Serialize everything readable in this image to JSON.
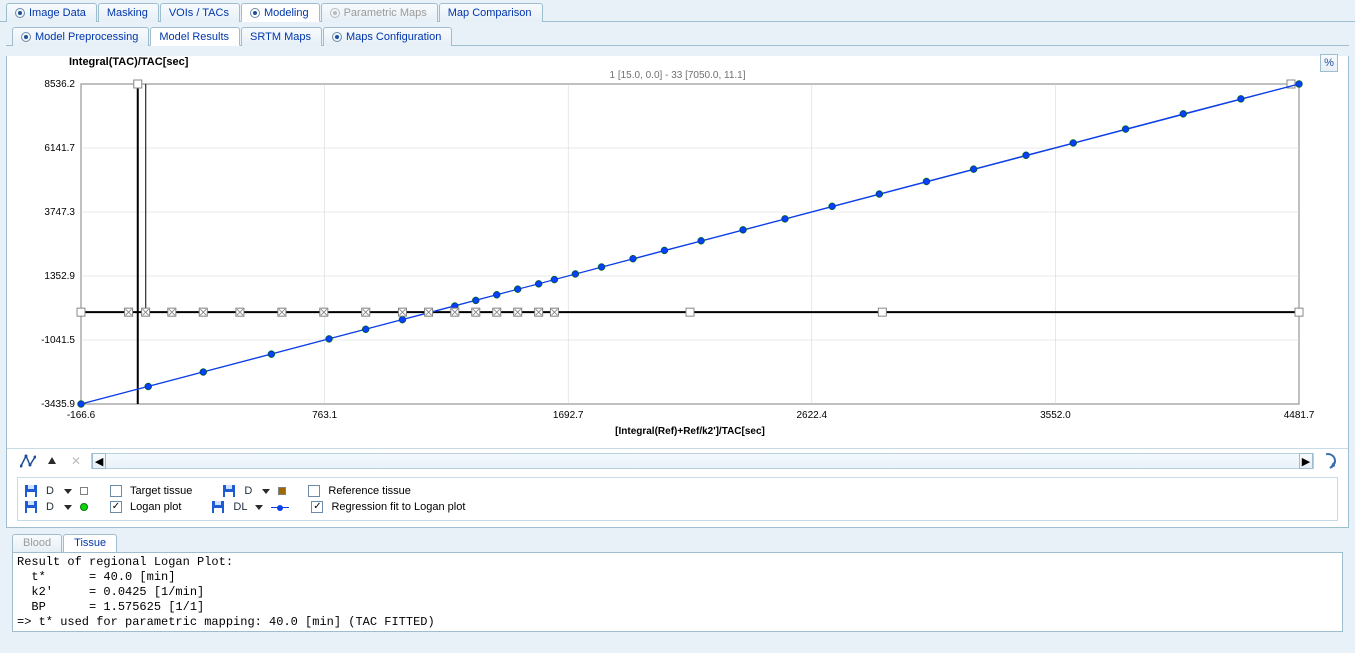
{
  "main_tabs": {
    "image_data": "Image Data",
    "masking": "Masking",
    "vois_tacs": "VOIs / TACs",
    "modeling": "Modeling",
    "parametric_maps": "Parametric Maps",
    "map_comparison": "Map Comparison"
  },
  "sub_tabs": {
    "model_preprocessing": "Model Preprocessing",
    "model_results": "Model Results",
    "srtm_maps": "SRTM Maps",
    "maps_configuration": "Maps Configuration"
  },
  "chart": {
    "title": "Integral(TAC)/TAC[sec]",
    "subtitle": "1 [15.0, 0.0] - 33 [7050.0, 11.1]",
    "xlabel": "[Integral(Ref)+Ref/k2']/TAC[sec]",
    "ylim": [
      -3435.9,
      8536.2
    ],
    "xlim": [
      -166.6,
      4481.7
    ],
    "yticks": [
      -3435.9,
      -1041.5,
      1352.9,
      3747.3,
      6141.7,
      8536.2
    ],
    "xticks": [
      -166.6,
      763.1,
      1692.7,
      2622.4,
      3552.0,
      4481.7
    ],
    "pct_label": "%"
  },
  "chart_data": {
    "type": "scatter+line",
    "title": "Integral(TAC)/TAC[sec]",
    "xlabel": "[Integral(Ref)+Ref/k2']/TAC[sec]",
    "ylabel": "Integral(TAC)/TAC[sec]",
    "xlim": [
      -166.6,
      4481.7
    ],
    "ylim": [
      -3435.9,
      8536.2
    ],
    "series": [
      {
        "name": "Target tissue",
        "marker": "square-open",
        "color": "#808080",
        "points": [
          [
            15,
            0
          ],
          [
            80,
            0
          ],
          [
            180,
            0
          ],
          [
            300,
            0
          ],
          [
            440,
            0
          ],
          [
            600,
            0
          ],
          [
            760,
            0
          ],
          [
            920,
            0
          ],
          [
            1060,
            0
          ],
          [
            1160,
            0
          ],
          [
            1260,
            0
          ],
          [
            1340,
            0
          ],
          [
            1420,
            0
          ],
          [
            1500,
            0
          ],
          [
            1580,
            0
          ],
          [
            1640,
            0
          ]
        ]
      },
      {
        "name": "Reference tissue",
        "marker": "square-filled",
        "color": "#a06800",
        "points": []
      },
      {
        "name": "Logan plot",
        "marker": "circle",
        "color": "#0bd60b",
        "points": [
          [
            -166.6,
            -3435.9
          ],
          [
            90,
            -2780
          ],
          [
            300,
            -2240
          ],
          [
            560,
            -1570
          ],
          [
            780,
            -1000
          ],
          [
            920,
            -640
          ],
          [
            1060,
            -280
          ],
          [
            1160,
            -30
          ],
          [
            1260,
            230
          ],
          [
            1340,
            440
          ],
          [
            1420,
            650
          ],
          [
            1500,
            860
          ],
          [
            1580,
            1060
          ],
          [
            1640,
            1220
          ],
          [
            1720,
            1430
          ],
          [
            1820,
            1690
          ],
          [
            1940,
            2000
          ],
          [
            2060,
            2310
          ],
          [
            2200,
            2670
          ],
          [
            2360,
            3080
          ],
          [
            2520,
            3490
          ],
          [
            2700,
            3960
          ],
          [
            2880,
            4420
          ],
          [
            3060,
            4890
          ],
          [
            3240,
            5350
          ],
          [
            3440,
            5870
          ],
          [
            3620,
            6330
          ],
          [
            3820,
            6850
          ],
          [
            4040,
            7420
          ],
          [
            4260,
            7980
          ],
          [
            4481.7,
            8536.2
          ]
        ]
      },
      {
        "name": "Regression fit to Logan plot",
        "type": "line",
        "color": "#0d3fe8",
        "points": [
          [
            -166.6,
            -3435.9
          ],
          [
            4481.7,
            8536.2
          ]
        ]
      }
    ]
  },
  "legend": {
    "d1": "D",
    "target_tissue": "Target tissue",
    "d2": "D",
    "reference_tissue": "Reference tissue",
    "d3": "D",
    "logan_plot": "Logan plot",
    "dl": "DL",
    "regression": "Regression fit to Logan plot"
  },
  "bottom_tabs": {
    "blood": "Blood",
    "tissue": "Tissue"
  },
  "output": {
    "l1": "Result of regional Logan Plot:",
    "l2": "  t*      = 40.0 [min]",
    "l3": "  k2'     = 0.0425 [1/min]",
    "l4": "  BP      = 1.575625 [1/1]",
    "l5": "=> t* used for parametric mapping: 40.0 [min] (TAC FITTED)"
  }
}
